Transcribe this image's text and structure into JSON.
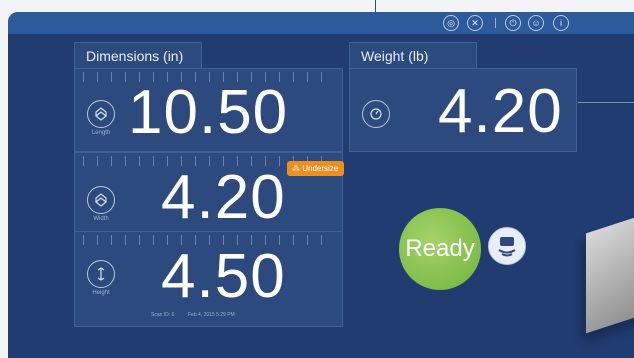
{
  "toolbar": {
    "buttons": [
      {
        "name": "settings-icon",
        "glyph": "◎"
      },
      {
        "name": "close-icon",
        "glyph": "✕"
      },
      {
        "name": "power-icon",
        "glyph": "⏻"
      },
      {
        "name": "profile-icon",
        "glyph": "☺"
      },
      {
        "name": "info-icon",
        "glyph": "i"
      }
    ]
  },
  "dimensions": {
    "title": "Dimensions (in)",
    "rows": [
      {
        "label": "Length",
        "value": "10.50"
      },
      {
        "label": "Width",
        "value": "4.20",
        "badge": "Undersize"
      },
      {
        "label": "Height",
        "value": "4.50"
      }
    ],
    "scan_id": "Scan ID: 6",
    "timestamp": "Feb 4, 2015 5:29 PM"
  },
  "weight": {
    "title": "Weight (lb)",
    "value": "4.20"
  },
  "status": {
    "label": "Ready"
  },
  "colors": {
    "background": "#203c70",
    "panel": "#2c4a7e",
    "badge": "#ee8f22",
    "ready": "#7cc043"
  }
}
